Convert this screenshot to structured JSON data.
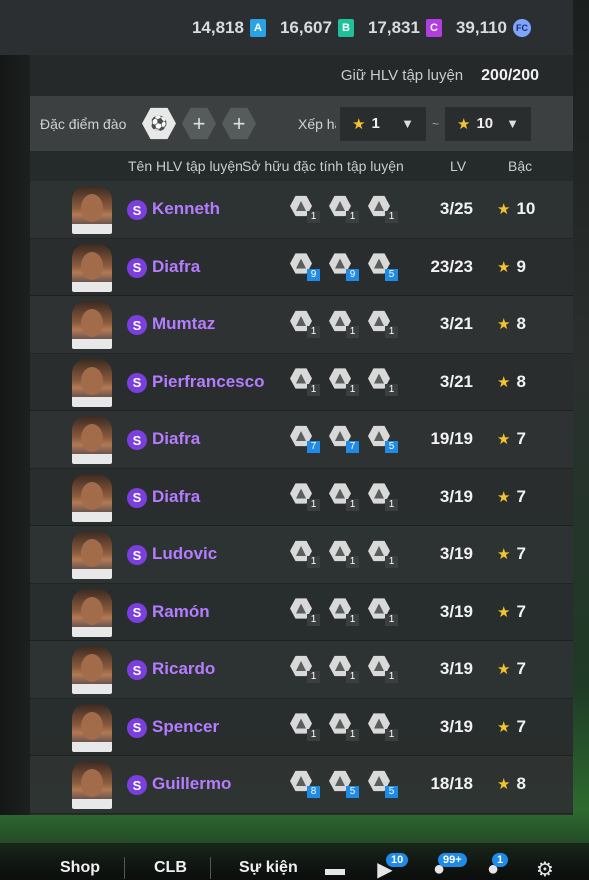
{
  "currency": [
    {
      "value": "14,818",
      "icon": "A",
      "icon_name": "a-token-icon",
      "color": "#2aa3e6"
    },
    {
      "value": "16,607",
      "icon": "B",
      "icon_name": "b-token-icon",
      "color": "#1fc19a"
    },
    {
      "value": "17,831",
      "icon": "C",
      "icon_name": "c-token-icon",
      "color": "#b23ee0"
    },
    {
      "value": "39,110",
      "icon": "FC",
      "icon_name": "fc-coin-icon",
      "color": "#7da7ff"
    }
  ],
  "hold": {
    "label": "Giữ HLV tập luyện",
    "value": "200/200"
  },
  "filter": {
    "trait_label": "Đặc điểm đào",
    "rank_label": "Xếp hạng",
    "rank_min": "1",
    "rank_max": "10",
    "range_sep": "~"
  },
  "columns": {
    "name": "Tên HLV tập luyện",
    "owned": "Sở hữu đặc tính tập luyện",
    "lv": "LV",
    "rank": "Bậc"
  },
  "coaches": [
    {
      "name": "Kenneth",
      "badge": "S",
      "traits": [
        "1",
        "1",
        "1"
      ],
      "traits_highlight": [
        false,
        false,
        false
      ],
      "lv": "3/25",
      "rank": "10"
    },
    {
      "name": "Diafra",
      "badge": "S",
      "traits": [
        "9",
        "9",
        "5"
      ],
      "traits_highlight": [
        true,
        true,
        true
      ],
      "lv": "23/23",
      "rank": "9"
    },
    {
      "name": "Mumtaz",
      "badge": "S",
      "traits": [
        "1",
        "1",
        "1"
      ],
      "traits_highlight": [
        false,
        false,
        false
      ],
      "lv": "3/21",
      "rank": "8"
    },
    {
      "name": "Pierfrancesco",
      "badge": "S",
      "traits": [
        "1",
        "1",
        "1"
      ],
      "traits_highlight": [
        false,
        false,
        false
      ],
      "lv": "3/21",
      "rank": "8"
    },
    {
      "name": "Diafra",
      "badge": "S",
      "traits": [
        "7",
        "7",
        "5"
      ],
      "traits_highlight": [
        true,
        true,
        true
      ],
      "lv": "19/19",
      "rank": "7"
    },
    {
      "name": "Diafra",
      "badge": "S",
      "traits": [
        "1",
        "1",
        "1"
      ],
      "traits_highlight": [
        false,
        false,
        false
      ],
      "lv": "3/19",
      "rank": "7"
    },
    {
      "name": "Ludovic",
      "badge": "S",
      "traits": [
        "1",
        "1",
        "1"
      ],
      "traits_highlight": [
        false,
        false,
        false
      ],
      "lv": "3/19",
      "rank": "7"
    },
    {
      "name": "Ramón",
      "badge": "S",
      "traits": [
        "1",
        "1",
        "1"
      ],
      "traits_highlight": [
        false,
        false,
        false
      ],
      "lv": "3/19",
      "rank": "7"
    },
    {
      "name": "Ricardo",
      "badge": "S",
      "traits": [
        "1",
        "1",
        "1"
      ],
      "traits_highlight": [
        false,
        false,
        false
      ],
      "lv": "3/19",
      "rank": "7"
    },
    {
      "name": "Spencer",
      "badge": "S",
      "traits": [
        "1",
        "1",
        "1"
      ],
      "traits_highlight": [
        false,
        false,
        false
      ],
      "lv": "3/19",
      "rank": "7"
    },
    {
      "name": "Guillermo",
      "badge": "S",
      "traits": [
        "8",
        "5",
        "5"
      ],
      "traits_highlight": [
        true,
        true,
        true
      ],
      "lv": "18/18",
      "rank": "8"
    }
  ],
  "nav": {
    "items": [
      "Shop",
      "CLB",
      "Sự kiện"
    ],
    "badges": {
      "play": "10",
      "friends": "99+",
      "profile": "1"
    }
  }
}
